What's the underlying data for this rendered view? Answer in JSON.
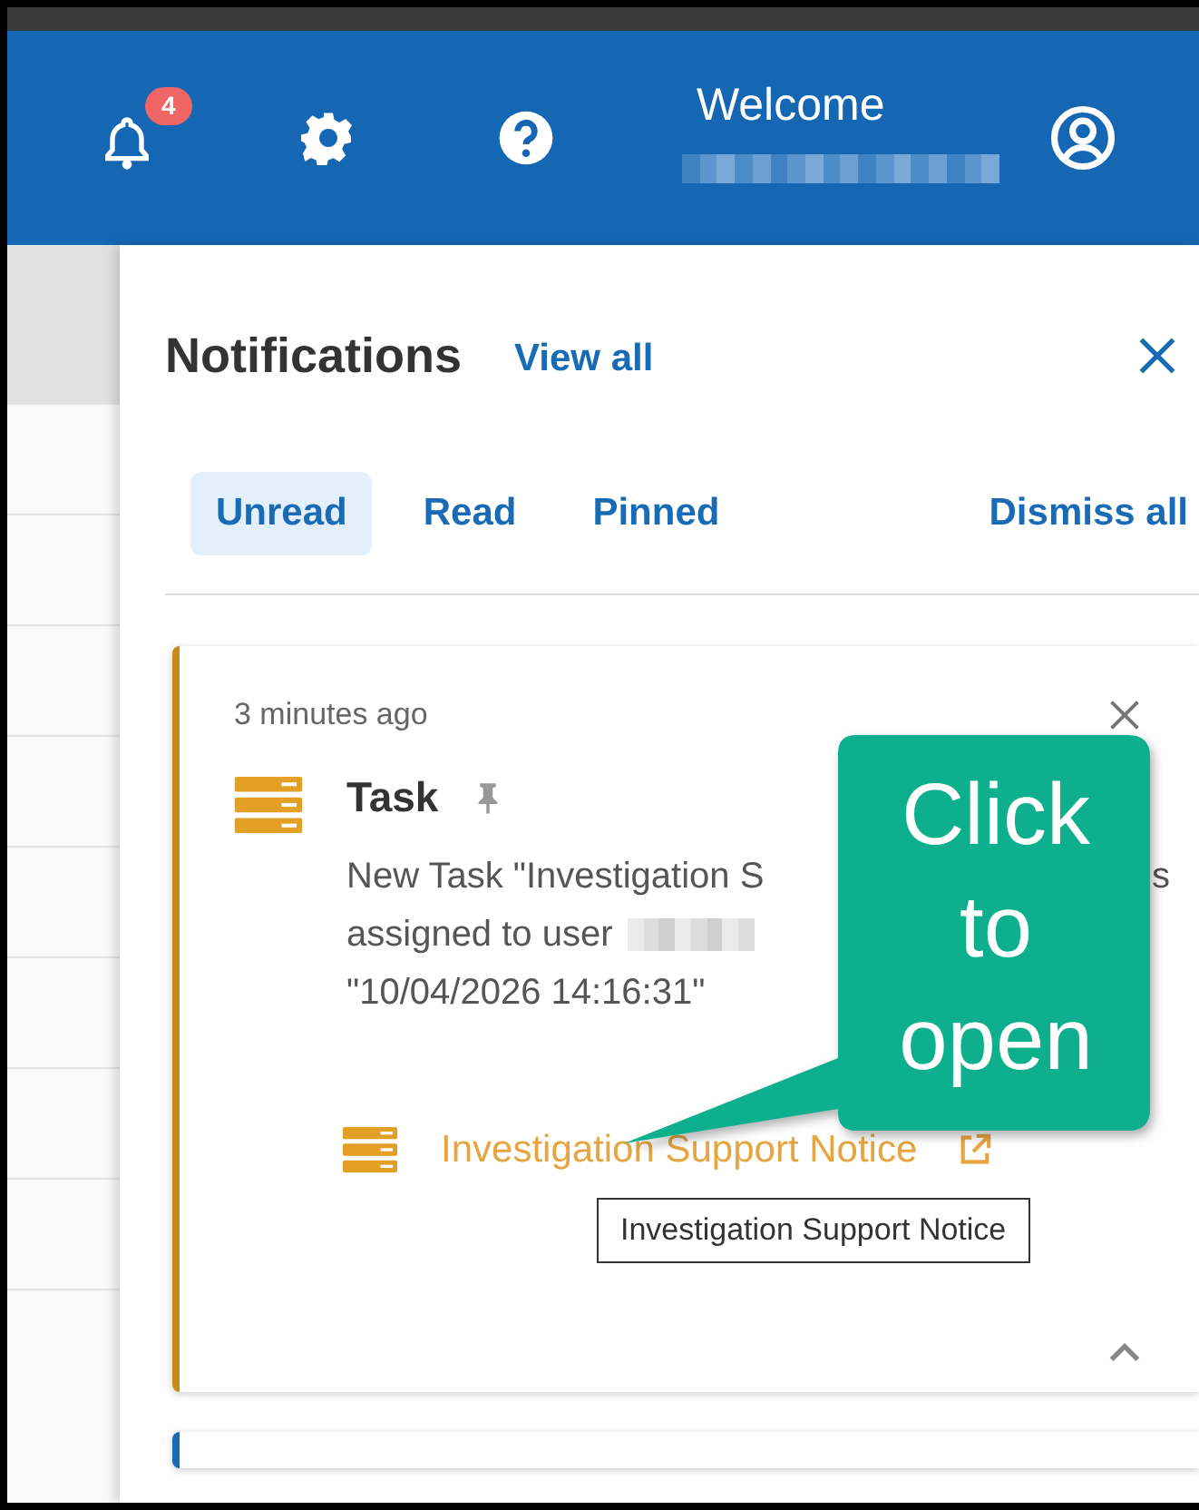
{
  "header": {
    "badge": "4",
    "welcome": "Welcome"
  },
  "panel": {
    "title": "Notifications",
    "view_all": "View all",
    "dismiss_all": "Dismiss all",
    "tabs": [
      {
        "label": "Unread",
        "selected": true
      },
      {
        "label": "Read",
        "selected": false
      },
      {
        "label": "Pinned",
        "selected": false
      }
    ]
  },
  "notifications": [
    {
      "color": "#c98a1a",
      "time": "3 minutes ago",
      "type": "Task",
      "body_lines": [
        [
          "New Task \"Investigation S",
          "s"
        ],
        [
          "assigned to user"
        ],
        [
          "\"10/04/2026 14:16:31\""
        ]
      ],
      "link": "Investigation Support Notice",
      "tooltip": "Investigation Support Notice"
    },
    {
      "color": "#1a6bb5"
    }
  ],
  "callout": {
    "text": "Click to open"
  }
}
